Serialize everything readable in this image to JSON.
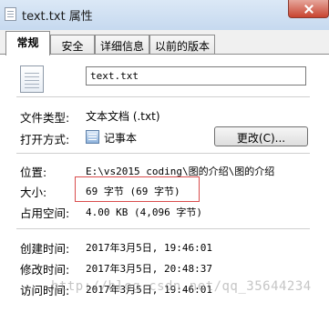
{
  "window": {
    "title": "text.txt 属性"
  },
  "tabs": [
    {
      "label": "常规",
      "active": true
    },
    {
      "label": "安全",
      "active": false
    },
    {
      "label": "详细信息",
      "active": false
    },
    {
      "label": "以前的版本",
      "active": false
    }
  ],
  "general": {
    "file_name": "text.txt",
    "file_type": {
      "label": "文件类型:",
      "value": "文本文档 (.txt)"
    },
    "open_with": {
      "label": "打开方式:",
      "value": "记事本",
      "button": "更改(C)..."
    },
    "location": {
      "label": "位置:",
      "value": "E:\\vs2015 coding\\图的介绍\\图的介绍"
    },
    "size": {
      "label": "大小:",
      "value": "69 字节 (69 字节)"
    },
    "size_on_disk": {
      "label": "占用空间:",
      "value": "4.00 KB (4,096 字节)"
    },
    "created": {
      "label": "创建时间:",
      "value": "2017年3月5日, 19:46:01"
    },
    "modified": {
      "label": "修改时间:",
      "value": "2017年3月5日, 20:48:37"
    },
    "accessed": {
      "label": "访问时间:",
      "value": "2017年3月5日, 19:46:01"
    }
  },
  "watermark": "http://blog.csdn.net/qq_35644234",
  "colors": {
    "highlight": "#d94c4c",
    "titlebar": "#c6d9ef",
    "close": "#c8432f"
  },
  "icons": [
    "text-file-icon",
    "notepad-icon",
    "close-icon"
  ]
}
